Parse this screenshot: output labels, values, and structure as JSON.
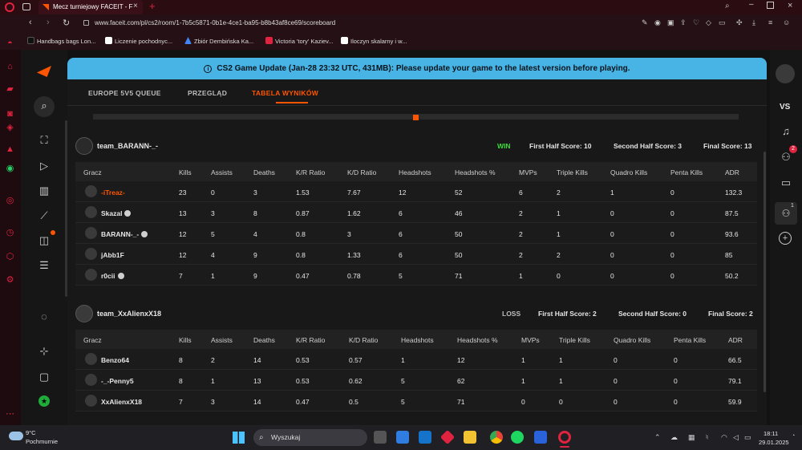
{
  "browser": {
    "tab_title": "Mecz turniejowy FACEIT - F",
    "address": "www.faceit.com/pl/cs2/room/1-7b5c5871-0b1e-4ce1-ba95-b8b43af8ce69/scoreboard",
    "bookmarks": [
      {
        "label": "Handbags bags Lon...",
        "color": "#111111"
      },
      {
        "label": "Liczenie pochodnyc...",
        "color": "#ffffff"
      },
      {
        "label": "Zbiór Dembińska Ka...",
        "color": "#4285f4"
      },
      {
        "label": "Victoria 'tory' Kaziev...",
        "color": "#e0233f"
      },
      {
        "label": "Iloczyn skalarny i w...",
        "color": "#ffffff"
      }
    ]
  },
  "banner": {
    "text": "CS2 Game Update (Jan-28 23:32 UTC, 431MB): Please update your game to the latest version before playing."
  },
  "tabs": [
    {
      "label": "EUROPE 5V5 QUEUE",
      "active": false
    },
    {
      "label": "PRZEGLĄD",
      "active": false
    },
    {
      "label": "TABELA WYNIKÓW",
      "active": true
    }
  ],
  "columns": [
    "Gracz",
    "Kills",
    "Assists",
    "Deaths",
    "K/R Ratio",
    "K/D Ratio",
    "Headshots",
    "Headshots %",
    "MVPs",
    "Triple Kills",
    "Quadro Kills",
    "Penta Kills",
    "ADR"
  ],
  "teams": [
    {
      "name": "team_BARANN-_-",
      "result": "WIN",
      "first_half": "First Half Score: 10",
      "second_half": "Second Half Score: 3",
      "final": "Final Score: 13",
      "players": [
        {
          "name": "-iTreaz-",
          "highlight": true,
          "verified": false,
          "stats": [
            "23",
            "0",
            "3",
            "1.53",
            "7.67",
            "12",
            "52",
            "6",
            "2",
            "1",
            "0",
            "132.3"
          ]
        },
        {
          "name": "Skazal",
          "highlight": false,
          "verified": true,
          "stats": [
            "13",
            "3",
            "8",
            "0.87",
            "1.62",
            "6",
            "46",
            "2",
            "1",
            "0",
            "0",
            "87.5"
          ]
        },
        {
          "name": "BARANN-_-",
          "highlight": false,
          "verified": true,
          "stats": [
            "12",
            "5",
            "4",
            "0.8",
            "3",
            "6",
            "50",
            "2",
            "1",
            "0",
            "0",
            "93.6"
          ]
        },
        {
          "name": "jAbb1F",
          "highlight": false,
          "verified": false,
          "stats": [
            "12",
            "4",
            "9",
            "0.8",
            "1.33",
            "6",
            "50",
            "2",
            "2",
            "0",
            "0",
            "85"
          ]
        },
        {
          "name": "r0cii",
          "highlight": false,
          "verified": true,
          "stats": [
            "7",
            "1",
            "9",
            "0.47",
            "0.78",
            "5",
            "71",
            "1",
            "0",
            "0",
            "0",
            "50.2"
          ]
        }
      ]
    },
    {
      "name": "team_XxAlienxX18",
      "result": "LOSS",
      "first_half": "First Half Score: 2",
      "second_half": "Second Half Score: 0",
      "final": "Final Score: 2",
      "players": [
        {
          "name": "Benzo64",
          "highlight": false,
          "verified": false,
          "stats": [
            "8",
            "2",
            "14",
            "0.53",
            "0.57",
            "1",
            "12",
            "1",
            "1",
            "0",
            "0",
            "66.5"
          ]
        },
        {
          "name": "-_-Penny5",
          "highlight": false,
          "verified": false,
          "stats": [
            "8",
            "1",
            "13",
            "0.53",
            "0.62",
            "5",
            "62",
            "1",
            "1",
            "0",
            "0",
            "79.1"
          ]
        },
        {
          "name": "XxAlienxX18",
          "highlight": false,
          "verified": false,
          "stats": [
            "7",
            "3",
            "14",
            "0.47",
            "0.5",
            "5",
            "71",
            "0",
            "0",
            "0",
            "0",
            "59.9"
          ]
        }
      ]
    }
  ],
  "right_rail": {
    "vs_label": "VS",
    "notif_badge": "2",
    "party_badge": "1"
  },
  "taskbar": {
    "weather_temp": "9°C",
    "weather_desc": "Pochmurnie",
    "search_placeholder": "Wyszukaj",
    "time": "18:11",
    "date": "29.01.2025"
  }
}
